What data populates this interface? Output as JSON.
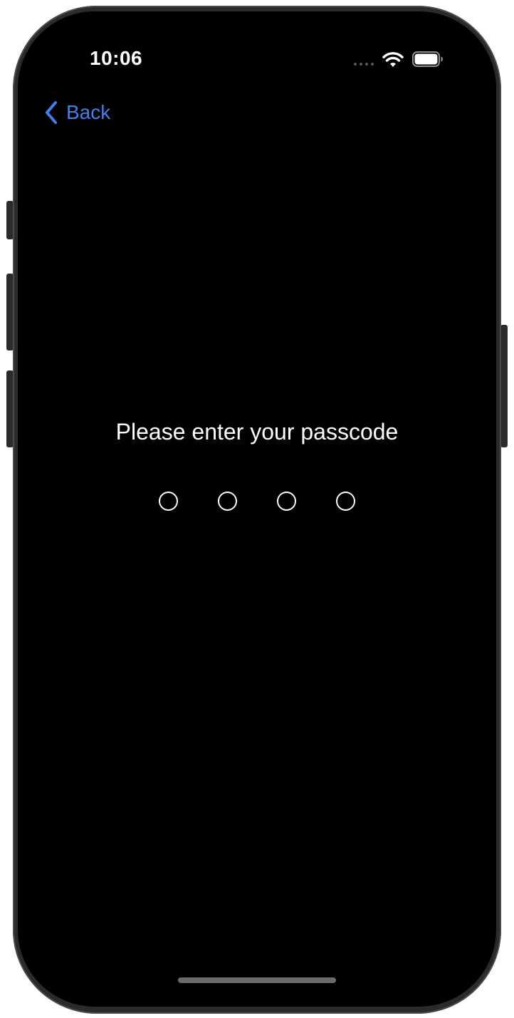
{
  "status_bar": {
    "time": "10:06",
    "icons": [
      "signal-dots-icon",
      "wifi-icon",
      "battery-icon"
    ]
  },
  "nav": {
    "back_label": "Back",
    "back_icon": "chevron-left-icon",
    "accent_color": "#3b82f0"
  },
  "passcode": {
    "prompt": "Please enter your passcode",
    "length": 4,
    "entered": 0
  }
}
